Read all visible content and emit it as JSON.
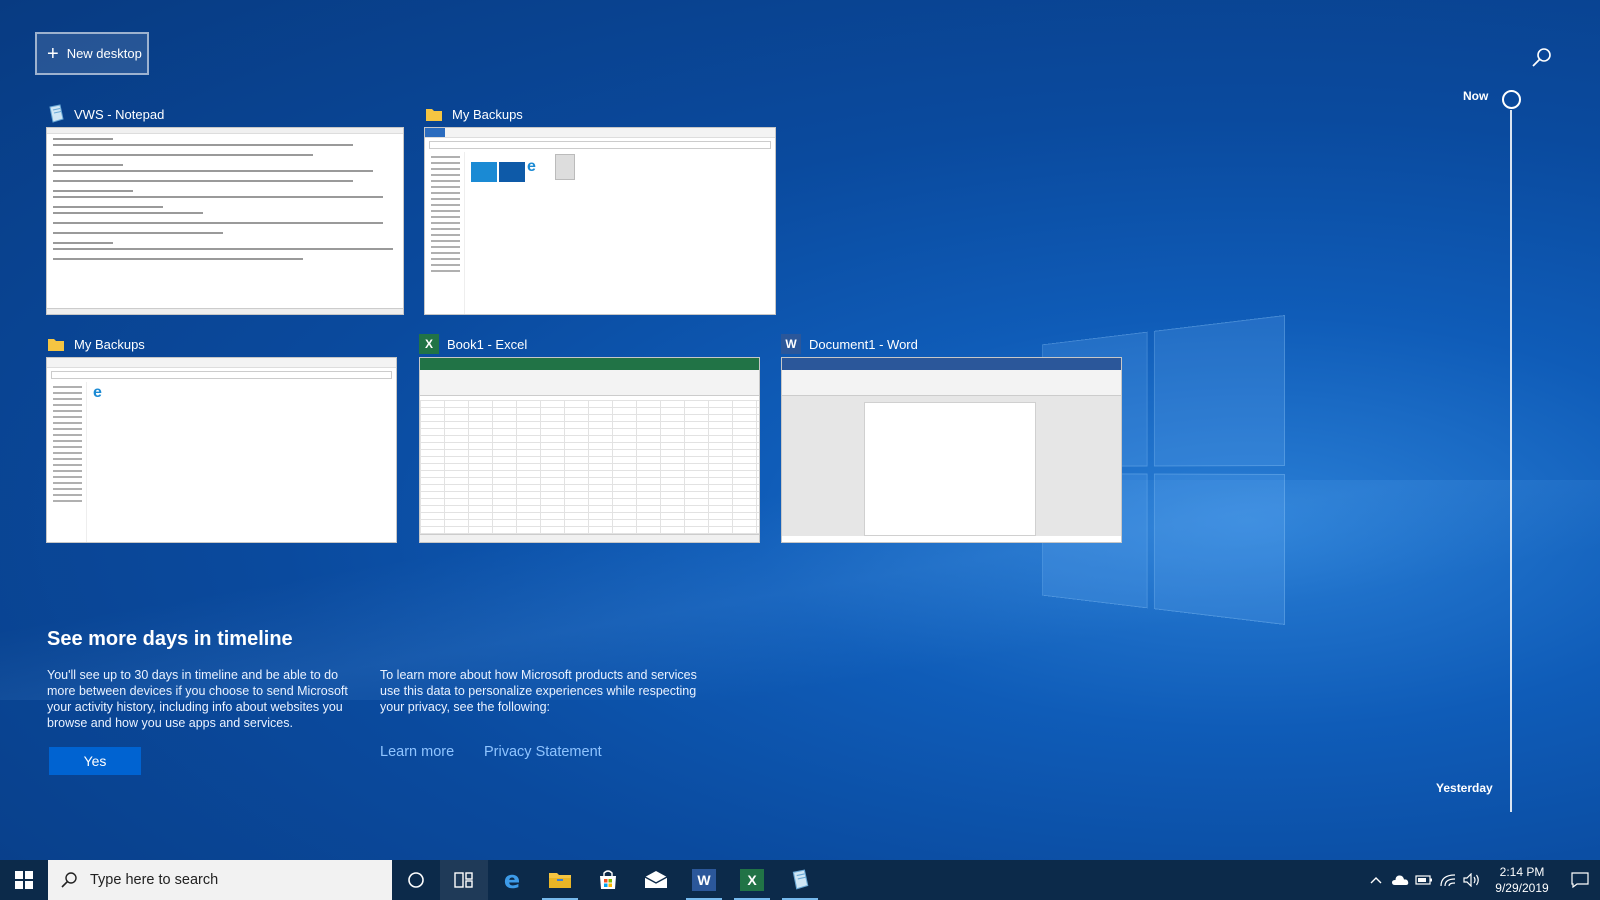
{
  "new_desktop": {
    "label": "New desktop"
  },
  "windows": [
    {
      "title": "VWS - Notepad"
    },
    {
      "title": "My Backups"
    },
    {
      "title": "My Backups"
    },
    {
      "title": "Book1 - Excel"
    },
    {
      "title": "Document1 - Word"
    }
  ],
  "timeline_promo": {
    "title": "See more days in timeline",
    "description": "You'll see up to 30 days in timeline and be able to do more between devices if you choose to send Microsoft your activity history, including info about websites you browse and how you use apps and services.",
    "privacy_text": "To learn more about how Microsoft products and services use this data to personalize experiences while respecting your privacy, see the following:",
    "learn_more": "Learn more",
    "privacy_statement": "Privacy Statement",
    "yes_label": "Yes"
  },
  "timeline": {
    "now": "Now",
    "yesterday": "Yesterday"
  },
  "taskbar": {
    "search_placeholder": "Type here to search",
    "time": "2:14 PM",
    "date": "9/29/2019"
  },
  "colors": {
    "accent": "#0063d1",
    "taskbar": "#0c2a4a",
    "link": "#8fc4ff",
    "excel": "#217346",
    "word": "#2b579a"
  }
}
